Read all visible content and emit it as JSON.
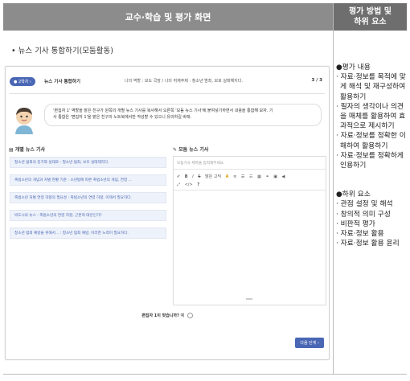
{
  "header": {
    "main_title": "교수·학습 및 평가 화면",
    "side_title_1": "평가 방법 및",
    "side_title_2": "하위 요소"
  },
  "lead_text": "• 뉴스 기사 통합하기(모둠활동)",
  "panel": {
    "topbar": {
      "badge": "● 2학차 ›",
      "title": "뉴스 기사 통합하기",
      "role": "나의 역할 : 보도 국장 / 나의 취재주제 : 청소년 범죄, 보호 실태해지다.",
      "page": "3 / 3"
    },
    "bubble_text_1": "'편집자 1' 역할을 맡은 친구가 원쪽의 개별 뉴스 기사를 복사해서 오른쪽 '모둠 뉴스 기사'에 붙여넣기하면서 내용을 통합해 보자. 기",
    "bubble_text_2": "사 통합은 '편집자 1'을 맡은 친구의 노트북에서만 작성할 수 있으니 유의하길 바래.",
    "left_section_title": "▤ 개별 뉴스 기사",
    "right_section_title": "✎ 모둠 뉴스 기사",
    "news_items": [
      "청소년 범죄의 증가와 실태로 : 청소년 범죄, 보호 실태해지다.",
      "촉법소년의 개념과 처벌 현황 기준 : 소년법에 따른 촉법소년의 개념, 연령 ...",
      "촉법소년 처벌 연령 하향의 필요성 : 촉법소년의 연령 하향, 이제서 필요하다.",
      "박도시의 뉴스 : 촉법소년의 연령 하향, 근본적 대안인가?",
      "청소년 범죄 예방을 위해서... : 청소년 범죄 예방, 이러한 노력이 필요하다."
    ],
    "editor": {
      "title_placeholder": "모둠기사 제목을 입력해주세요.",
      "toolbar_row1": [
        "✐",
        "B",
        "I",
        "S",
        "맑은 고딕",
        "A",
        "≡",
        "☰",
        "☷",
        "▦",
        "⚭",
        "▣",
        "◀"
      ],
      "toolbar_row2": [
        "⤢",
        "</>",
        "?"
      ]
    },
    "check_label": "편집자 1이 맞습니까?",
    "check_option": "예",
    "next_button": "다음 단계 ›"
  },
  "side": {
    "eval_head": "●평가 내용",
    "eval_items": [
      "· 자료·정보를 목적에 맞게 해석 및 재구성하여 활용하기",
      "· 필자의 생각이나 의견을 매체를 활용하여 효과적으로 제시하기",
      "· 자료·정보를 정확한 이해하여 활용하기",
      "· 자료·정보를 정확하게 인용하기"
    ],
    "sub_head": "●하위 요소",
    "sub_items": [
      "· 관점 설정 및 해석",
      "· 창의적 의미 구성",
      "· 비판적 평가",
      "· 자료·정보 활용",
      "· 자료·정보 활용 윤리"
    ]
  }
}
